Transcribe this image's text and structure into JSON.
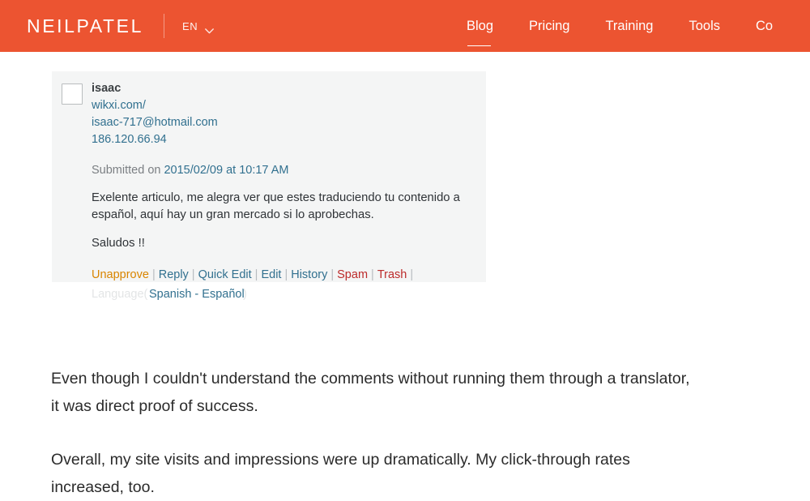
{
  "header": {
    "brand": "NEILPATEL",
    "language_code": "EN",
    "chevron_icon": "chevron-down-icon",
    "nav": [
      {
        "label": "Blog",
        "active": true
      },
      {
        "label": "Pricing",
        "active": false
      },
      {
        "label": "Training",
        "active": false
      },
      {
        "label": "Tools",
        "active": false
      },
      {
        "label": "Co",
        "active": false
      }
    ],
    "colors": {
      "background": "#ec5431",
      "text": "#ffffff"
    }
  },
  "comment": {
    "checkbox_checked": false,
    "author_name": "isaac",
    "author_url": "wikxi.com/",
    "author_email": "isaac-717@hotmail.com",
    "author_ip": "186.120.66.94",
    "submitted_label": "Submitted on",
    "submitted_datetime": "2015/02/09 at 10:17 AM",
    "body_paragraph_1": "Exelente articulo, me alegra ver que estes traduciendo tu contenido a español, aquí hay un gran mercado si lo aprobechas.",
    "body_paragraph_2": "Saludos !!",
    "actions": [
      {
        "label": "Unapprove",
        "color": "#d98500"
      },
      {
        "label": "Reply",
        "color": "#31708f"
      },
      {
        "label": "Quick Edit",
        "color": "#31708f"
      },
      {
        "label": "Edit",
        "color": "#31708f"
      },
      {
        "label": "History",
        "color": "#31708f"
      },
      {
        "label": "Spam",
        "color": "#bc2b2b"
      },
      {
        "label": "Trash",
        "color": "#bc2b2b"
      }
    ],
    "action_separator": "|",
    "language_label": "Language(",
    "language_value": "Spanish - Español",
    "language_paren_close": ")",
    "colors": {
      "card_background": "#f4f5f5",
      "link": "#31708f"
    }
  },
  "article": {
    "paragraph_1": "Even though I couldn't understand the comments without running them through a translator, it was direct proof of success.",
    "paragraph_2": "Overall, my site visits and impressions were up dramatically. My click-through rates increased, too."
  }
}
